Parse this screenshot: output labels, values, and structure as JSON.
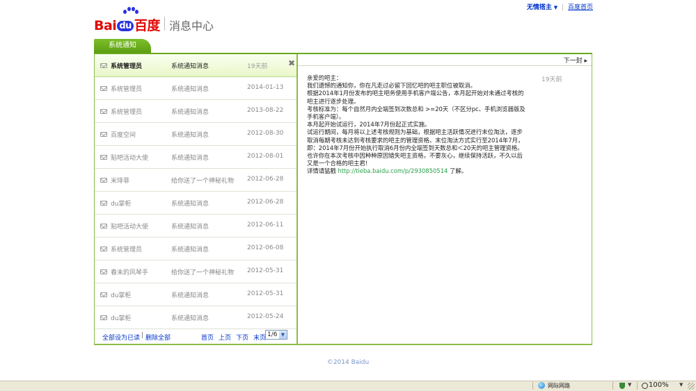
{
  "header": {
    "logo_brand_a": "Bai",
    "logo_brand_du": "du",
    "logo_brand_cn": "百度",
    "page_title": "消息中心",
    "user_name": "无情搭主",
    "home_link": "百度首页"
  },
  "tab": {
    "label": "系统通知"
  },
  "list": {
    "rows": [
      {
        "sender": "系统管理员",
        "subject": "系统通知消息",
        "date": "19天前",
        "active": true
      },
      {
        "sender": "系统管理员",
        "subject": "系统通知消息",
        "date": "2014-01-13"
      },
      {
        "sender": "系统管理员",
        "subject": "系统通知消息",
        "date": "2013-08-22"
      },
      {
        "sender": "百度空间",
        "subject": "系统通知消息",
        "date": "2012-08-30"
      },
      {
        "sender": "贴吧活动大使",
        "subject": "系统通知消息",
        "date": "2012-08-01"
      },
      {
        "sender": "米琲菲",
        "subject": "给你送了一个神秘礼物",
        "date": "2012-06-28"
      },
      {
        "sender": "du掌柜",
        "subject": "系统通知消息",
        "date": "2012-06-28"
      },
      {
        "sender": "贴吧活动大使",
        "subject": "系统通知消息",
        "date": "2012-06-11"
      },
      {
        "sender": "系统管理员",
        "subject": "系统通知消息",
        "date": "2012-06-08"
      },
      {
        "sender": "春末的风琴手",
        "subject": "给你送了一个神秘礼物",
        "date": "2012-05-31"
      },
      {
        "sender": "du掌柜",
        "subject": "系统通知消息",
        "date": "2012-05-31"
      },
      {
        "sender": "du掌柜",
        "subject": "系统通知消息",
        "date": "2012-05-24"
      }
    ],
    "close_symbol": "✖",
    "mark_all_read": "全部设为已读",
    "separator": "|",
    "delete_all": "删除全部",
    "pager": {
      "first": "首页",
      "prev": "上页",
      "next": "下页",
      "last": "末页",
      "page_value": "1/6"
    }
  },
  "detail": {
    "next_label": "下一封",
    "time": "19天前",
    "lines": [
      "亲爱的吧主：",
      "我们遗憾的通知你，你在凡走过必留下回忆吧的吧主职位被取消。",
      "根据2014年1月份发布的吧主吧务使用手机客户端公告，本月起开始对未通过考核的吧主进行逐步处理。",
      "考核标准为：每个自然月内全端签到次数总和 >=20天（不区分pc、手机浏览器版及手机客户端）。",
      "本月起开始试运行，2014年7月份起正式实施。",
      "试运行期间，每月将以上述考核规则为基础，根据吧主活跃情况进行末位淘汰，逐步取消每期考核未达到考核要求的吧主的管理资格。末位淘汰方式实行至2014年7月，即：2014年7月份开始执行取消6月份内全端签到天数总和＜20天的吧主管理资格。",
      "也许你在本次考核中因种种原因错失吧主资格，不要灰心，继续保持活跃，不久以后又是一个合格的吧主君!"
    ],
    "last_prefix": "详情请猛戳 ",
    "link": "http://tieba.baidu.com/p/2930850514",
    "last_suffix": " 了解。"
  },
  "footer": {
    "copyright": "©2014 Baidu"
  },
  "statusbar": {
    "zone": "网际网路",
    "zoom": "100%"
  }
}
